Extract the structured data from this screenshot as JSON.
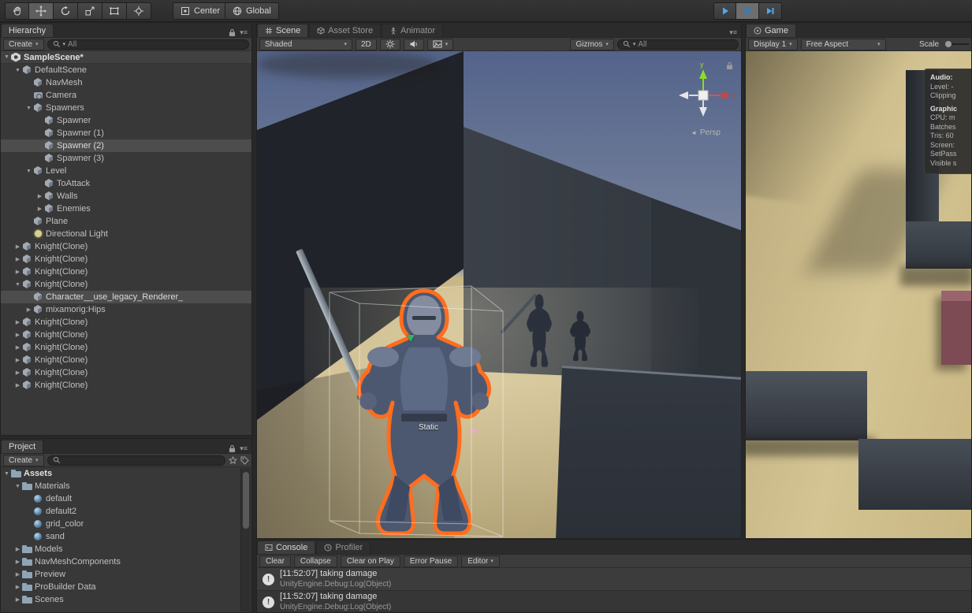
{
  "top_toolbar": {
    "tools": [
      {
        "name": "hand-tool",
        "active": false
      },
      {
        "name": "move-tool",
        "active": true
      },
      {
        "name": "rotate-tool",
        "active": false
      },
      {
        "name": "scale-tool",
        "active": false
      },
      {
        "name": "rect-tool",
        "active": false
      },
      {
        "name": "transform-tool",
        "active": false
      }
    ],
    "pivot_label": "Center",
    "orientation_label": "Global",
    "playback": {
      "playing": true,
      "paused": true
    }
  },
  "hierarchy": {
    "tab_label": "Hierarchy",
    "create_label": "Create",
    "search_value": "All",
    "items": [
      {
        "label": "SampleScene*",
        "depth": 0,
        "arrow": "v",
        "icon": "unity-scene-icon",
        "header": true
      },
      {
        "label": "DefaultScene",
        "depth": 1,
        "arrow": "v",
        "icon": "gameobject-icon"
      },
      {
        "label": "NavMesh",
        "depth": 2,
        "arrow": "",
        "icon": "gameobject-icon"
      },
      {
        "label": "Camera",
        "depth": 2,
        "arrow": "",
        "icon": "camera-icon"
      },
      {
        "label": "Spawners",
        "depth": 2,
        "arrow": "v",
        "icon": "gameobject-icon"
      },
      {
        "label": "Spawner",
        "depth": 3,
        "arrow": "",
        "icon": "gameobject-icon"
      },
      {
        "label": "Spawner (1)",
        "depth": 3,
        "arrow": "",
        "icon": "gameobject-icon"
      },
      {
        "label": "Spawner (2)",
        "depth": 3,
        "arrow": "",
        "icon": "gameobject-icon",
        "selected": true
      },
      {
        "label": "Spawner (3)",
        "depth": 3,
        "arrow": "",
        "icon": "gameobject-icon"
      },
      {
        "label": "Level",
        "depth": 2,
        "arrow": "v",
        "icon": "gameobject-icon"
      },
      {
        "label": "ToAttack",
        "depth": 3,
        "arrow": "",
        "icon": "gameobject-icon"
      },
      {
        "label": "Walls",
        "depth": 3,
        "arrow": ">",
        "icon": "gameobject-icon"
      },
      {
        "label": "Enemies",
        "depth": 3,
        "arrow": ">",
        "icon": "gameobject-icon"
      },
      {
        "label": "Plane",
        "depth": 2,
        "arrow": "",
        "icon": "gameobject-icon"
      },
      {
        "label": "Directional Light",
        "depth": 2,
        "arrow": "",
        "icon": "light-icon"
      },
      {
        "label": "Knight(Clone)",
        "depth": 1,
        "arrow": ">",
        "icon": "gameobject-icon"
      },
      {
        "label": "Knight(Clone)",
        "depth": 1,
        "arrow": ">",
        "icon": "gameobject-icon"
      },
      {
        "label": "Knight(Clone)",
        "depth": 1,
        "arrow": ">",
        "icon": "gameobject-icon"
      },
      {
        "label": "Knight(Clone)",
        "depth": 1,
        "arrow": "v",
        "icon": "gameobject-icon"
      },
      {
        "label": "Character__use_legacy_Renderer_",
        "depth": 2,
        "arrow": "",
        "icon": "gameobject-icon",
        "selected": true
      },
      {
        "label": "mixamorig:Hips",
        "depth": 2,
        "arrow": ">",
        "icon": "gameobject-icon"
      },
      {
        "label": "Knight(Clone)",
        "depth": 1,
        "arrow": ">",
        "icon": "gameobject-icon"
      },
      {
        "label": "Knight(Clone)",
        "depth": 1,
        "arrow": ">",
        "icon": "gameobject-icon"
      },
      {
        "label": "Knight(Clone)",
        "depth": 1,
        "arrow": ">",
        "icon": "gameobject-icon"
      },
      {
        "label": "Knight(Clone)",
        "depth": 1,
        "arrow": ">",
        "icon": "gameobject-icon"
      },
      {
        "label": "Knight(Clone)",
        "depth": 1,
        "arrow": ">",
        "icon": "gameobject-icon"
      },
      {
        "label": "Knight(Clone)",
        "depth": 1,
        "arrow": ">",
        "icon": "gameobject-icon"
      }
    ]
  },
  "project": {
    "tab_label": "Project",
    "create_label": "Create",
    "search_value": "",
    "items": [
      {
        "label": "Assets",
        "depth": 0,
        "arrow": "v",
        "icon": "folder-icon",
        "bold": true
      },
      {
        "label": "Materials",
        "depth": 1,
        "arrow": "v",
        "icon": "folder-icon"
      },
      {
        "label": "default",
        "depth": 2,
        "arrow": "",
        "icon": "material-icon"
      },
      {
        "label": "default2",
        "depth": 2,
        "arrow": "",
        "icon": "material-icon"
      },
      {
        "label": "grid_color",
        "depth": 2,
        "arrow": "",
        "icon": "material-icon"
      },
      {
        "label": "sand",
        "depth": 2,
        "arrow": "",
        "icon": "material-icon"
      },
      {
        "label": "Models",
        "depth": 1,
        "arrow": ">",
        "icon": "folder-icon"
      },
      {
        "label": "NavMeshComponents",
        "depth": 1,
        "arrow": ">",
        "icon": "folder-icon"
      },
      {
        "label": "Preview",
        "depth": 1,
        "arrow": ">",
        "icon": "folder-icon"
      },
      {
        "label": "ProBuilder Data",
        "depth": 1,
        "arrow": ">",
        "icon": "folder-icon"
      },
      {
        "label": "Scenes",
        "depth": 1,
        "arrow": ">",
        "icon": "folder-icon"
      }
    ]
  },
  "scene": {
    "tabs": [
      {
        "label": "Scene"
      },
      {
        "label": "Asset Store"
      },
      {
        "label": "Animator"
      }
    ],
    "toolbar": {
      "shading": "Shaded",
      "mode_2d": "2D",
      "gizmos_label": "Gizmos",
      "search_value": "All"
    },
    "gizmo": {
      "y_label": "y",
      "x_label": "x",
      "persp_label": "Persp"
    },
    "static_label": "Static"
  },
  "game": {
    "tab_label": "Game",
    "toolbar": {
      "display": "Display 1",
      "aspect": "Free Aspect",
      "scale_label": "Scale"
    },
    "stats": {
      "audio_title": "Audio:",
      "audio_lines": [
        "Level: -",
        "Clipping"
      ],
      "graphics_title": "Graphic",
      "graphics_lines": [
        "CPU: m",
        "Batches",
        "Tris: 60",
        "Screen:",
        "SetPass",
        "Visible s"
      ]
    }
  },
  "console": {
    "tabs": [
      {
        "label": "Console"
      },
      {
        "label": "Profiler"
      }
    ],
    "buttons": [
      "Clear",
      "Collapse",
      "Clear on Play",
      "Error Pause"
    ],
    "editor_button": "Editor",
    "entries": [
      {
        "message": "[11:52:07] taking damage",
        "trace": "UnityEngine.Debug:Log(Object)"
      },
      {
        "message": "[11:52:07] taking damage",
        "trace": "UnityEngine.Debug:Log(Object)"
      }
    ]
  },
  "colors": {
    "selection_outline": "#ff6d1f",
    "play_accent": "#4aa9f4",
    "selection_row": "#4d4d4d"
  },
  "icons": {
    "collapse-icon": "▼",
    "expand-icon": "▶",
    "dropdown-icon": "▾",
    "menu-icon": "≡",
    "info-icon": "!"
  }
}
